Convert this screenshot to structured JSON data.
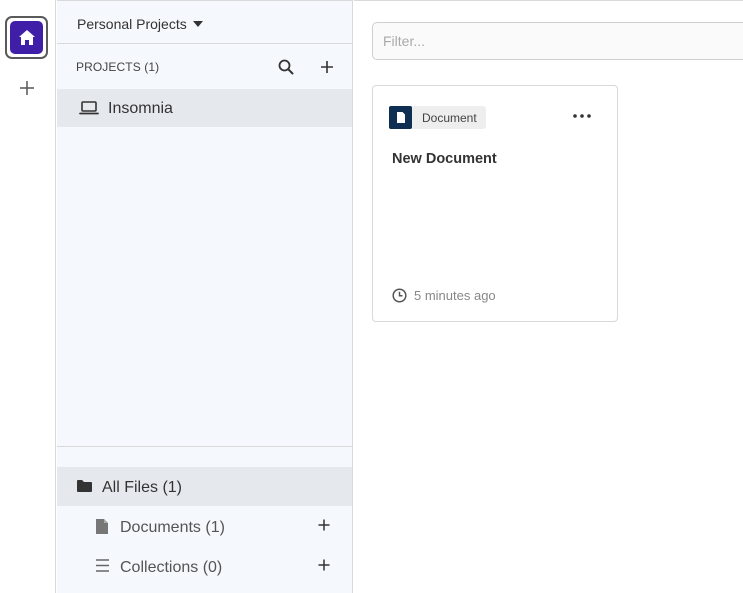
{
  "rail": {
    "home_icon": "home-icon",
    "add_icon": "plus-icon"
  },
  "sidebar": {
    "org_select": "Personal Projects",
    "projects_header": "PROJECTS (1)",
    "projects": [
      {
        "label": "Insomnia",
        "icon": "laptop-icon"
      }
    ],
    "files": {
      "all_files": "All Files (1)",
      "documents": "Documents (1)",
      "collections": "Collections (0)"
    }
  },
  "main": {
    "filter_placeholder": "Filter...",
    "cards": [
      {
        "type_label": "Document",
        "title": "New Document",
        "timestamp": "5 minutes ago"
      }
    ]
  },
  "colors": {
    "accent": "#3f1fa8",
    "doc_badge": "#0f2f52",
    "sidebar_bg": "#f5f8fc",
    "selected_bg": "#e5e9ee"
  }
}
